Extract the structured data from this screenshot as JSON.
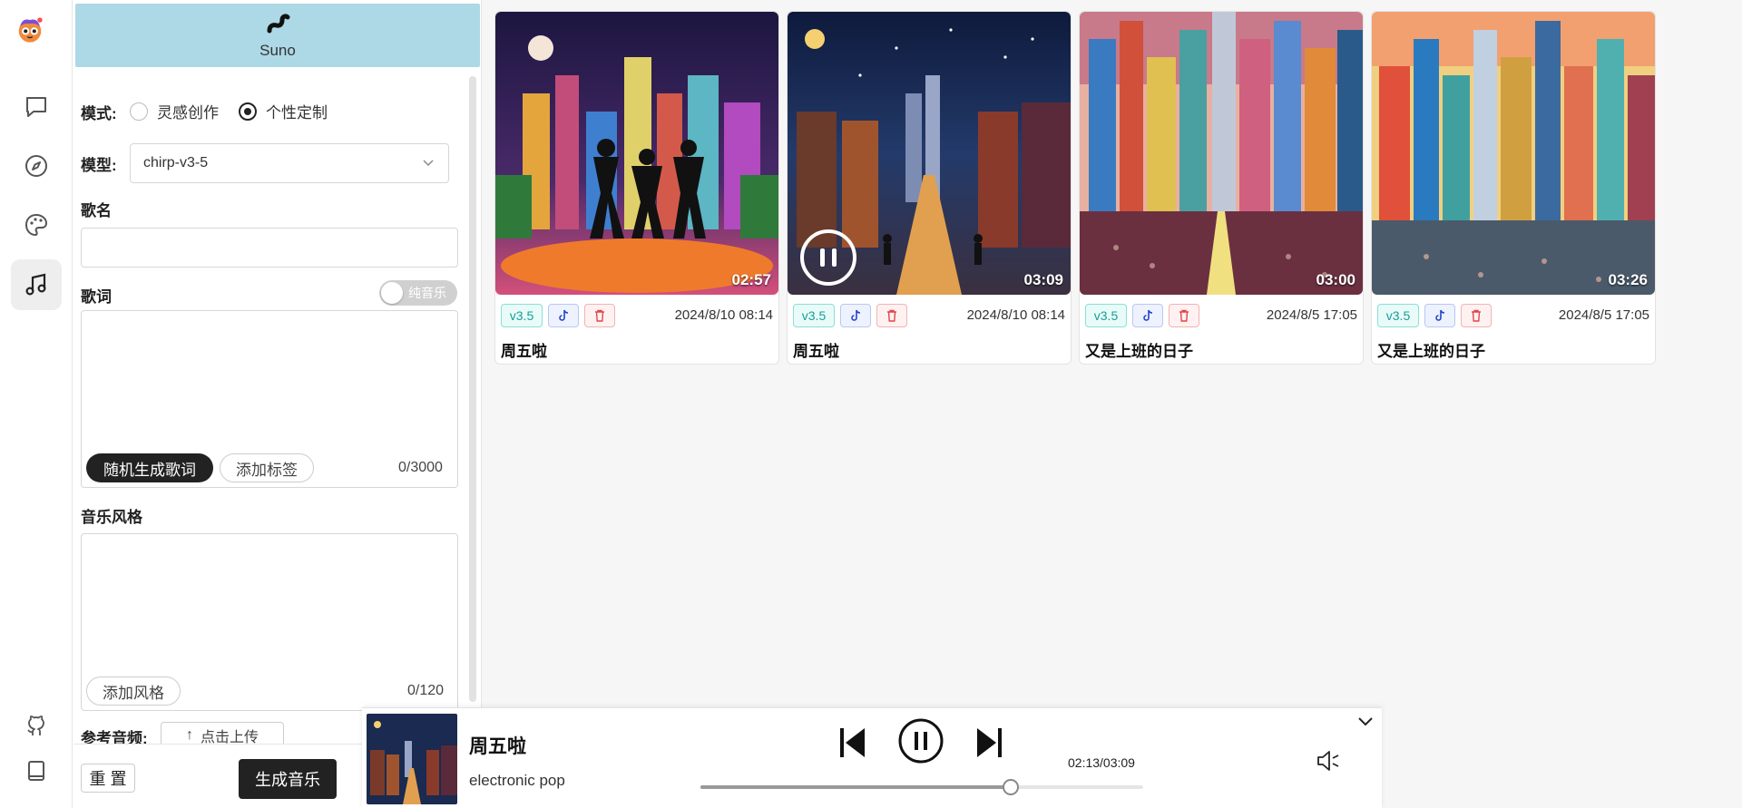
{
  "rail": {
    "items": [
      "chat",
      "discover",
      "palette",
      "music"
    ],
    "active": "music"
  },
  "panel": {
    "model_tab": {
      "label": "Suno"
    },
    "mode": {
      "label": "模式:",
      "options": [
        "灵感创作",
        "个性定制"
      ],
      "selected": "个性定制"
    },
    "model": {
      "label": "模型:",
      "value": "chirp-v3-5"
    },
    "song_name": {
      "label": "歌名",
      "value": ""
    },
    "lyrics": {
      "label": "歌词",
      "value": "",
      "toggle_label": "纯音乐",
      "random_button": "随机生成歌词",
      "add_tag_button": "添加标签",
      "counter": "0/3000"
    },
    "style": {
      "label": "音乐风格",
      "value": "",
      "add_style_button": "添加风格",
      "counter": "0/120"
    },
    "reference": {
      "label": "参考音频:",
      "upload_button": "点击上传"
    },
    "reset_button": "重 置",
    "generate_button": "生成音乐"
  },
  "cards": [
    {
      "version": "v3.5",
      "duration": "02:57",
      "date": "2024/8/10 08:14",
      "title": "周五啦",
      "playing": false
    },
    {
      "version": "v3.5",
      "duration": "03:09",
      "date": "2024/8/10 08:14",
      "title": "周五啦",
      "playing": true
    },
    {
      "version": "v3.5",
      "duration": "03:00",
      "date": "2024/8/5 17:05",
      "title": "又是上班的日子",
      "playing": false
    },
    {
      "version": "v3.5",
      "duration": "03:26",
      "date": "2024/8/5 17:05",
      "title": "又是上班的日子",
      "playing": false
    }
  ],
  "player": {
    "title": "周五啦",
    "style": "electronic pop",
    "time": "02:13/03:09",
    "progress": 0.7
  },
  "colors": {
    "model_tab_bg": "#add8e6",
    "version_tag": "#14a098",
    "tiktok_tag": "#2246c9",
    "delete_tag": "#e04646",
    "dark_button": "#222222"
  }
}
